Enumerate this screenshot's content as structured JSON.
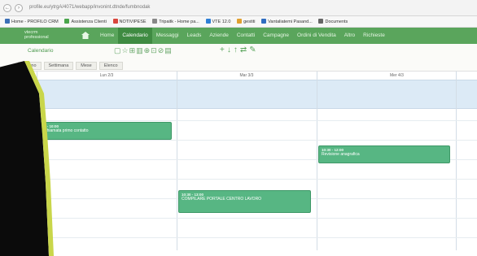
{
  "browser": {
    "url": "profile.eu/ytrgA/4071/webapp/invonint.dtnde/fumbnodak",
    "back_glyph": "←",
    "forward_glyph": "›",
    "bookmarks": [
      {
        "label": "Home - PROFILO CRM",
        "color": "#3b6fb6"
      },
      {
        "label": "Assistenza Clienti",
        "color": "#4aa54c"
      },
      {
        "label": "NOTIVIPESE",
        "color": "#d9463d"
      },
      {
        "label": "Tripaitk - Home pa...",
        "color": "#888888"
      },
      {
        "label": "VTE 12.0",
        "color": "#2f7fd6"
      },
      {
        "label": "gestiti",
        "color": "#e0a030"
      },
      {
        "label": "Vantaliatemi Pasand...",
        "color": "#2f6cc0"
      },
      {
        "label": "Documents",
        "color": "#666666"
      }
    ]
  },
  "app": {
    "logo_line1": "vtecrm",
    "logo_line2": "professional",
    "menu": [
      "Home",
      "Calendario",
      "Messaggi",
      "Leads",
      "Aziende",
      "Contatti",
      "Campagne",
      "Ordini di Vendita",
      "Altro",
      "Richieste"
    ],
    "active_menu": "Calendario"
  },
  "toolbar": {
    "title": "Calendario",
    "icon_glyphs": "▢☆⊞▥⊕⊡⊘▤",
    "arrow_glyphs": "+↓↑⇄✎",
    "views": [
      "Giorno",
      "Settimana",
      "Mese",
      "Elenco"
    ]
  },
  "calendar": {
    "columns": [
      "Lun 2/3",
      "Mar 3/3",
      "Mer 4/3"
    ],
    "events": [
      {
        "time": "8 - 10:00",
        "title": "Chiamata primo contatto"
      },
      {
        "time": "10:30 - 12:00",
        "title": "Revisione anagrafica"
      },
      {
        "time": "10:30 - 13:00",
        "title": "COMPILARE PORTALE CENTRO LAVORO"
      }
    ]
  },
  "colors": {
    "app_green": "#5aa55c",
    "event_green": "#57b683",
    "allday_blue": "#dceaf6"
  }
}
